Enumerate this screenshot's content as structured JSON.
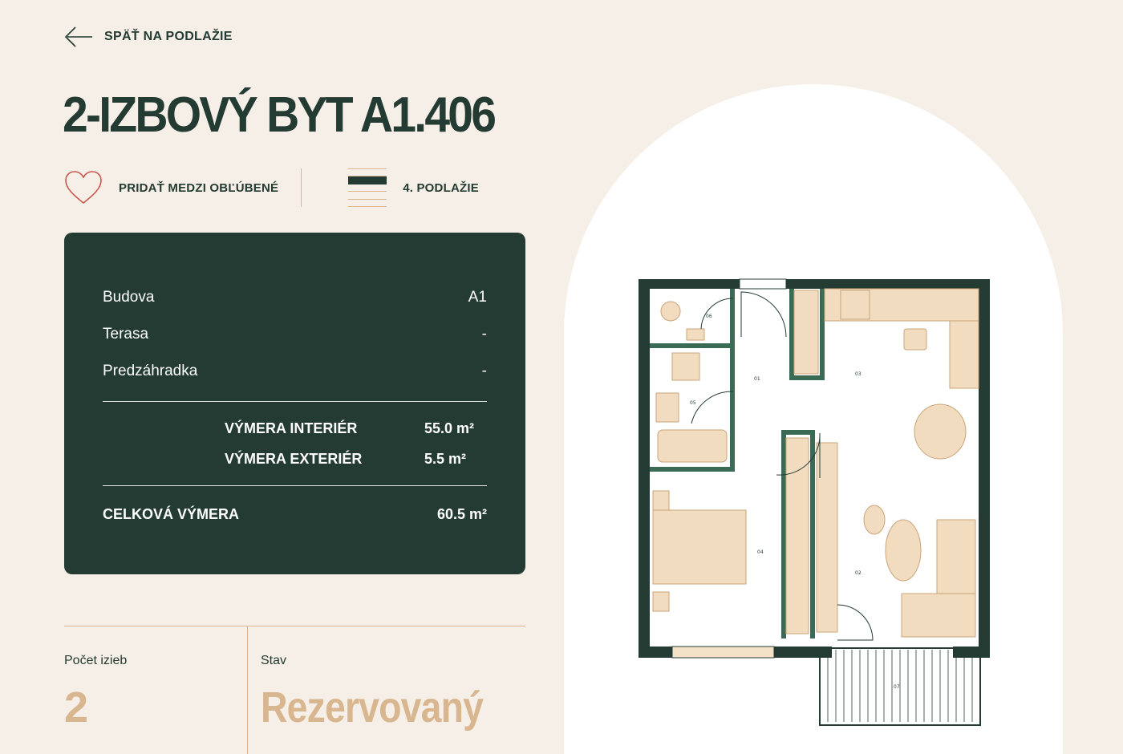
{
  "nav": {
    "back_label": "SPÄŤ NA PODLAŽIE"
  },
  "apartment": {
    "title": "2-IZBOVÝ BYT A1.406"
  },
  "actions": {
    "favorite_label": "PRIDAŤ MEDZI OBĽÚBENÉ",
    "floor_label": "4. PODLAŽIE"
  },
  "details": {
    "rows": [
      {
        "label": "Budova",
        "value": "A1"
      },
      {
        "label": "Terasa",
        "value": "-"
      },
      {
        "label": "Predzáhradka",
        "value": "-"
      }
    ],
    "areas": [
      {
        "label": "VÝMERA INTERIÉR",
        "value": "55.0 m²"
      },
      {
        "label": "VÝMERA EXTERIÉR",
        "value": "5.5 m²"
      }
    ],
    "total": {
      "label": "CELKOVÁ VÝMERA",
      "value": "60.5 m²"
    }
  },
  "stats": {
    "rooms_label": "Počet izieb",
    "rooms_value": "2",
    "status_label": "Stav",
    "status_value": "Rezervovaný"
  },
  "floorplan": {
    "rooms": [
      "01",
      "02",
      "03",
      "04",
      "05",
      "06",
      "07"
    ]
  },
  "colors": {
    "dark_green": "#233b32",
    "beige": "#f6efe7",
    "tan": "#d8b68f",
    "heart": "#c9574f"
  },
  "icons": [
    "arrow-left-icon",
    "heart-icon",
    "floor-stack-icon"
  ]
}
